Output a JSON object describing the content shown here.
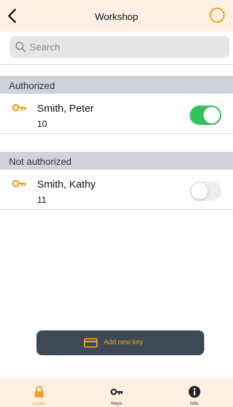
{
  "header": {
    "title": "Workshop",
    "back_icon": "chevron-left-icon",
    "status_icon": "circle-ring-icon"
  },
  "search": {
    "placeholder": "Search"
  },
  "sections": [
    {
      "title": "Authorized",
      "items": [
        {
          "name": "Smith, Peter",
          "number": "10",
          "authorized": true
        }
      ]
    },
    {
      "title": "Not authorized",
      "items": [
        {
          "name": "Smith, Kathy",
          "number": "11",
          "authorized": false
        }
      ]
    }
  ],
  "add_button": {
    "label": "Add new key",
    "icon": "card-icon"
  },
  "tabbar": {
    "tabs": [
      {
        "label": "Locks",
        "icon": "lock-icon",
        "active": true
      },
      {
        "label": "Keys",
        "icon": "key-icon",
        "active": false
      },
      {
        "label": "Info",
        "icon": "info-icon",
        "active": false
      }
    ]
  },
  "colors": {
    "accent": "#f0a020",
    "toggle_on": "#34c25a",
    "section_bg": "#cfd2da",
    "nav_bg": "#fdf0e3",
    "button_bg": "#3d4a56"
  }
}
